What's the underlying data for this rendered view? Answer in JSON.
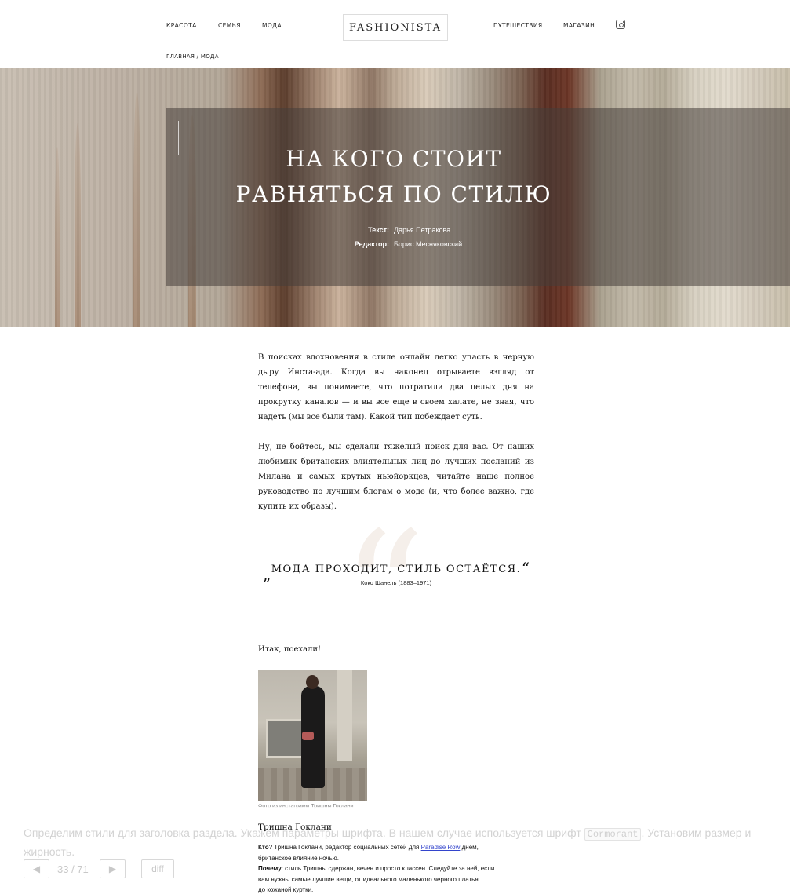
{
  "nav": {
    "left": [
      "КРАСОТА",
      "СЕМЬЯ",
      "МОДА"
    ],
    "logo": "FASHIONISTA",
    "right": [
      "ПУТЕШЕСТВИЯ",
      "МАГАЗИН"
    ],
    "icon": "instagram-icon"
  },
  "breadcrumb": {
    "home": "ГЛАВНАЯ",
    "sep": "/",
    "current": "МОДА"
  },
  "hero": {
    "title_line1": "НА КОГО СТОИТ",
    "title_line2": "РАВНЯТЬСЯ ПО СТИЛЮ",
    "text_label": "Текст:",
    "text_value": "Дарья Петракова",
    "editor_label": "Редактор:",
    "editor_value": "Борис Месняковский"
  },
  "article": {
    "p1": "В поисках вдохновения в стиле онлайн легко упасть в черную дыру Инста-ада. Когда вы наконец отрываете взгляд от телефона, вы понимаете, что потратили два целых дня на прокрутку каналов — и вы все еще в своем халате, не зная, что надеть (мы все были там). Какой тип побеждает суть.",
    "p2": "Ну, не бойтесь, мы сделали тяжелый поиск для вас. От наших любимых британских влиятельных лиц до лучших посланий из Милана и самых крутых ньюйоркцев, читайте наше полное руководство по лучшим блогам о моде (и, что более важно, где купить их образы).",
    "quote_open": "„",
    "quote_text": "МОДА ПРОХОДИТ, СТИЛЬ ОСТАЁТСЯ.",
    "quote_close": "“",
    "quote_bg": "“",
    "quote_author": "Коко Шанель (1883–1971)",
    "lead": "Итак, поехали!",
    "photo_caption": "Фото из инстаграмм Тришны Гоклани",
    "person_name": "Тришна Гоклани",
    "who_label": "Кто",
    "who_text_1": "? Тришна Гоклани, редактор социальных сетей для ",
    "who_link": "Paradise Row",
    "who_text_2": " днем,",
    "who_text_3": "британское влияние ночью.",
    "why_label": "Почему",
    "why_text_1": ": стиль Тришны сдержан, вечен и просто классен. Следуйте за ней, если",
    "why_text_2": "вам нужны самые лучшие вещи, от идеального маленького черного платья",
    "why_text_3": "до кожаной куртки."
  },
  "instruction": {
    "text_before": "Определим стили для заголовка раздела. Укажем параметры шрифта. В нашем случае используется шрифт ",
    "code": "Cormorant",
    "text_after": ". Установим размер и жирность.",
    "pager": "33 / 71",
    "prev_icon": "prev-arrow-icon",
    "next_icon": "next-arrow-icon",
    "diff_label": "diff"
  }
}
